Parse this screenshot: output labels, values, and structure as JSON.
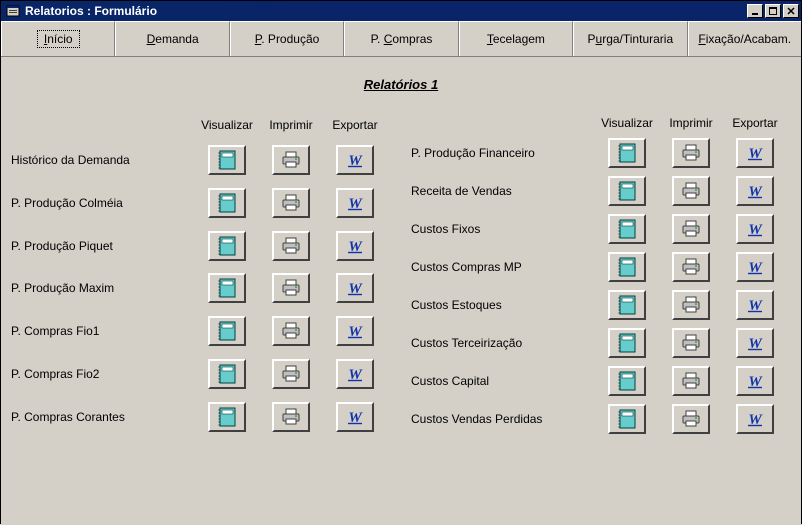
{
  "window": {
    "title": "Relatorios : Formulário"
  },
  "tabs": [
    {
      "labelPre": "",
      "accel": "I",
      "labelPost": "nício",
      "active": true
    },
    {
      "labelPre": "",
      "accel": "D",
      "labelPost": "emanda",
      "active": false
    },
    {
      "labelPre": "",
      "accel": "P",
      "labelPost": ". Produção",
      "active": false
    },
    {
      "labelPre": "P. ",
      "accel": "C",
      "labelPost": "ompras",
      "active": false
    },
    {
      "labelPre": "",
      "accel": "T",
      "labelPost": "ecelagem",
      "active": false
    },
    {
      "labelPre": "P",
      "accel": "u",
      "labelPost": "rga/Tinturaria",
      "active": false
    },
    {
      "labelPre": "",
      "accel": "F",
      "labelPost": "ixação/Acabam.",
      "active": false
    }
  ],
  "section": {
    "title": "Relatórios 1"
  },
  "headers": {
    "view": "Visualizar",
    "print": "Imprimir",
    "export": "Exportar"
  },
  "leftRows": [
    {
      "label": "Histórico da Demanda"
    },
    {
      "label": "P. Produção Colméia"
    },
    {
      "label": "P. Produção Piquet"
    },
    {
      "label": "P. Produção Maxim"
    },
    {
      "label": "P. Compras Fio1"
    },
    {
      "label": "P. Compras Fio2"
    },
    {
      "label": "P. Compras Corantes"
    }
  ],
  "rightRows": [
    {
      "label": "P. Produção Financeiro"
    },
    {
      "label": "Receita de Vendas"
    },
    {
      "label": "Custos Fixos"
    },
    {
      "label": "Custos Compras MP"
    },
    {
      "label": "Custos Estoques"
    },
    {
      "label": "Custos Terceirização"
    },
    {
      "label": "Custos Capital"
    },
    {
      "label": "Custos Vendas Perdidas"
    }
  ],
  "colors": {
    "titlebar": "#0a246a",
    "panel": "#d4d0c8",
    "notebookFill": "#66cccc",
    "wordBlue": "#1033aa"
  }
}
